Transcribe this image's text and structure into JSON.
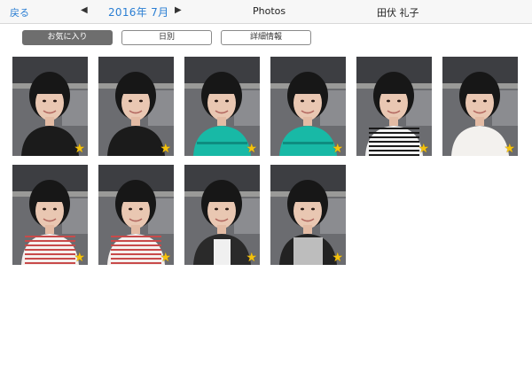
{
  "header": {
    "back_label": "戻る",
    "prev_arrow": "◀",
    "month_label": "2016年 7月",
    "next_arrow": "▶",
    "title": "Photos",
    "user_name": "田伏 礼子"
  },
  "tabs": [
    {
      "label": "お気に入り",
      "active": true
    },
    {
      "label": "日別",
      "active": false
    },
    {
      "label": "詳細情報",
      "active": false
    }
  ],
  "photos": [
    {
      "favorite": true,
      "star": "★",
      "clothing": "black"
    },
    {
      "favorite": true,
      "star": "★",
      "clothing": "black"
    },
    {
      "favorite": true,
      "star": "★",
      "clothing": "teal"
    },
    {
      "favorite": true,
      "star": "★",
      "clothing": "teal"
    },
    {
      "favorite": true,
      "star": "★",
      "clothing": "stripe"
    },
    {
      "favorite": true,
      "star": "★",
      "clothing": "white"
    },
    {
      "favorite": true,
      "star": "★",
      "clothing": "stripe-red"
    },
    {
      "favorite": true,
      "star": "★",
      "clothing": "stripe-red"
    },
    {
      "favorite": true,
      "star": "★",
      "clothing": "white-dark"
    },
    {
      "favorite": true,
      "star": "★",
      "clothing": "scarf"
    }
  ],
  "colors": {
    "accent": "#2a7ed3",
    "star": "#f4c20d",
    "active_tab": "#6e6e6e"
  }
}
